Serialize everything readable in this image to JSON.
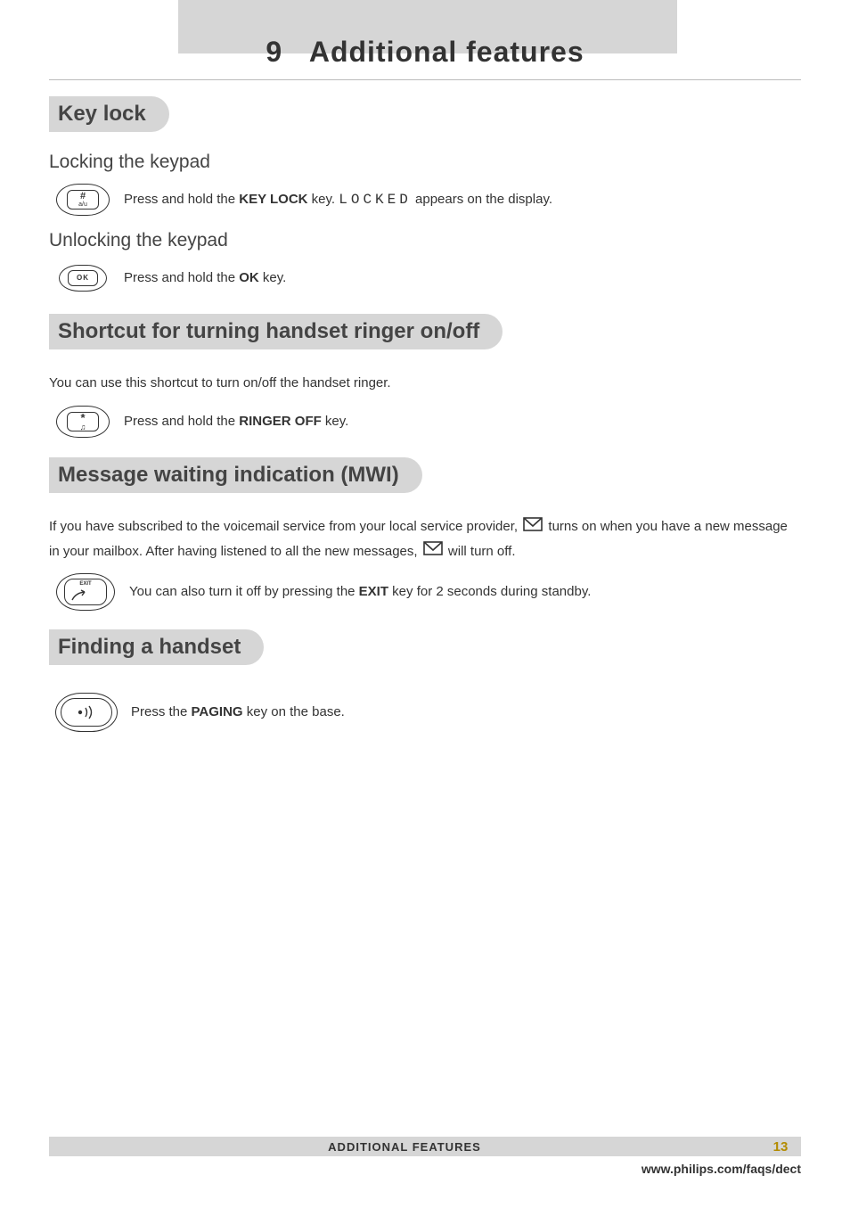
{
  "chapter": {
    "number": "9",
    "title": "Additional features"
  },
  "sections": {
    "keylock": {
      "heading": "Key lock",
      "locking": {
        "subheading": "Locking the keypad",
        "text_before": "Press and hold the ",
        "bold1": "KEY LOCK",
        "text_mid": " key. ",
        "lcd": "LOCKED",
        "text_after": " appears on the display."
      },
      "unlocking": {
        "subheading": "Unlocking the keypad",
        "text_before": "Press and hold the ",
        "bold1": "OK",
        "text_after": " key."
      }
    },
    "ringer": {
      "heading": "Shortcut for turning handset ringer on/off",
      "intro": "You can use this shortcut to turn on/off the handset ringer.",
      "step_before": "Press and hold the ",
      "step_bold": "RINGER OFF",
      "step_after": " key."
    },
    "mwi": {
      "heading": "Message waiting indication (MWI)",
      "p1_a": "If you have subscribed to the voicemail service from your local service provider, ",
      "p1_b": " turns on when you have a new message in your mailbox.  After having listened to all the new messages, ",
      "p1_c": " will turn off.",
      "step_before": "You can also turn it off by pressing the ",
      "step_bold": "EXIT",
      "step_after": " key for 2 seconds during standby."
    },
    "finding": {
      "heading": "Finding a handset",
      "step_before": "Press the ",
      "step_bold": "PAGING",
      "step_after": " key on the base."
    }
  },
  "footer": {
    "title": "ADDITIONAL FEATURES",
    "page": "13",
    "url": "www.philips.com/faqs/dect"
  },
  "icons": {
    "hash_key": "#",
    "hash_sub": "a/u",
    "ok_key": "OK",
    "star_key": "*",
    "star_sub": "♫",
    "exit_key": "EXIT"
  }
}
